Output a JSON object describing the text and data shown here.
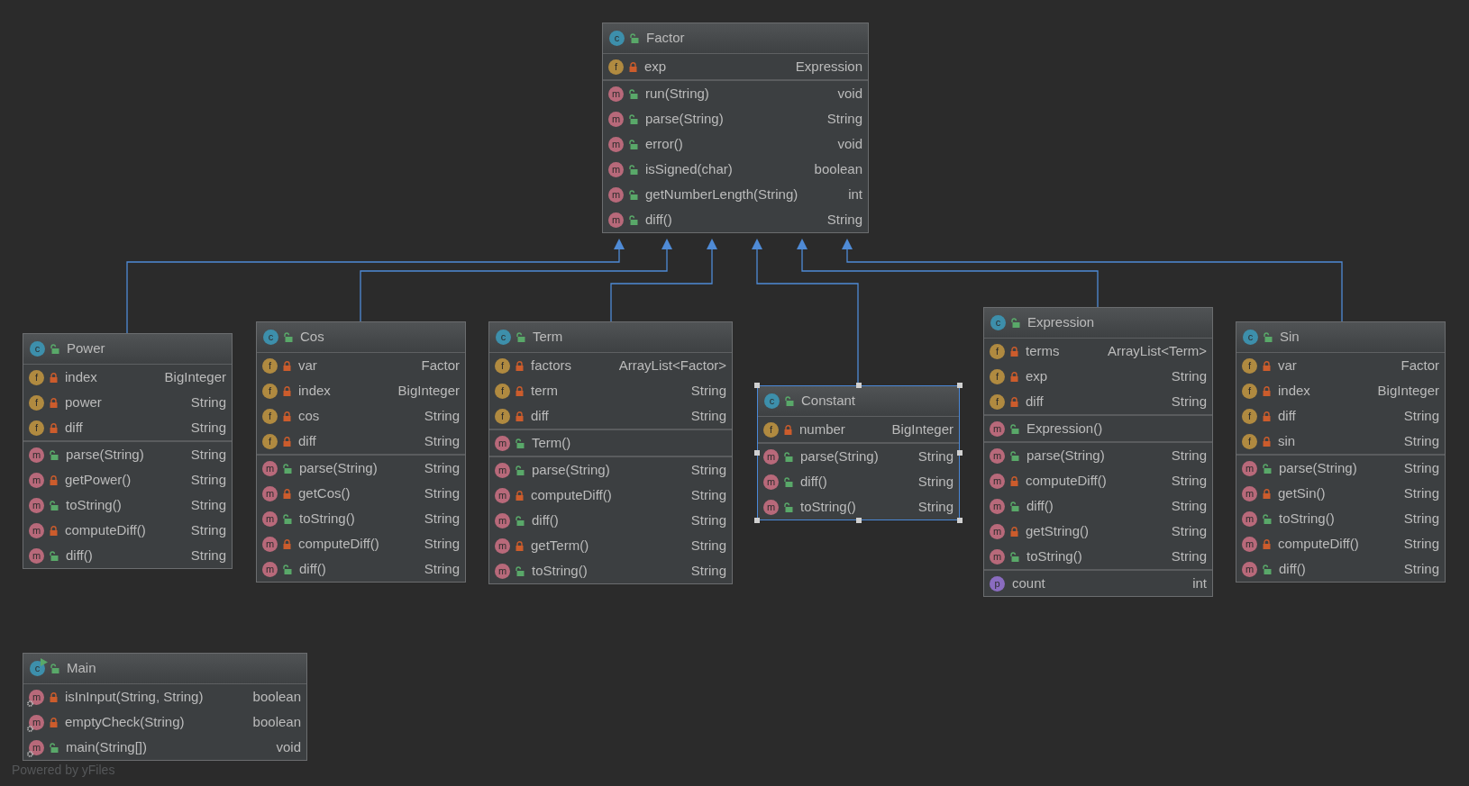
{
  "classes": [
    {
      "kind": "c",
      "name": "Factor",
      "runnable": false,
      "selected": false,
      "sections": [
        [
          {
            "kind": "f",
            "locked": true,
            "name": "exp",
            "type": "Expression"
          }
        ],
        [
          {
            "kind": "m",
            "locked": false,
            "name": "run(String)",
            "type": "void"
          },
          {
            "kind": "m",
            "locked": false,
            "name": "parse(String)",
            "type": "String"
          },
          {
            "kind": "m",
            "locked": false,
            "name": "error()",
            "type": "void"
          },
          {
            "kind": "m",
            "locked": false,
            "name": "isSigned(char)",
            "type": "boolean"
          },
          {
            "kind": "m",
            "locked": false,
            "name": "getNumberLength(String)",
            "type": "int"
          },
          {
            "kind": "m",
            "locked": false,
            "name": "diff()",
            "type": "String"
          }
        ]
      ]
    },
    {
      "kind": "c",
      "name": "Power",
      "runnable": false,
      "selected": false,
      "sections": [
        [
          {
            "kind": "f",
            "locked": true,
            "name": "index",
            "type": "BigInteger"
          },
          {
            "kind": "f",
            "locked": true,
            "name": "power",
            "type": "String"
          },
          {
            "kind": "f",
            "locked": true,
            "name": "diff",
            "type": "String"
          }
        ],
        [
          {
            "kind": "m",
            "locked": false,
            "name": "parse(String)",
            "type": "String"
          },
          {
            "kind": "m",
            "locked": true,
            "name": "getPower()",
            "type": "String"
          },
          {
            "kind": "m",
            "locked": false,
            "name": "toString()",
            "type": "String"
          },
          {
            "kind": "m",
            "locked": true,
            "name": "computeDiff()",
            "type": "String"
          },
          {
            "kind": "m",
            "locked": false,
            "name": "diff()",
            "type": "String"
          }
        ]
      ]
    },
    {
      "kind": "c",
      "name": "Cos",
      "runnable": false,
      "selected": false,
      "sections": [
        [
          {
            "kind": "f",
            "locked": true,
            "name": "var",
            "type": "Factor"
          },
          {
            "kind": "f",
            "locked": true,
            "name": "index",
            "type": "BigInteger"
          },
          {
            "kind": "f",
            "locked": true,
            "name": "cos",
            "type": "String"
          },
          {
            "kind": "f",
            "locked": true,
            "name": "diff",
            "type": "String"
          }
        ],
        [
          {
            "kind": "m",
            "locked": false,
            "name": "parse(String)",
            "type": "String"
          },
          {
            "kind": "m",
            "locked": true,
            "name": "getCos()",
            "type": "String"
          },
          {
            "kind": "m",
            "locked": false,
            "name": "toString()",
            "type": "String"
          },
          {
            "kind": "m",
            "locked": true,
            "name": "computeDiff()",
            "type": "String"
          },
          {
            "kind": "m",
            "locked": false,
            "name": "diff()",
            "type": "String"
          }
        ]
      ]
    },
    {
      "kind": "c",
      "name": "Term",
      "runnable": false,
      "selected": false,
      "sections": [
        [
          {
            "kind": "f",
            "locked": true,
            "name": "factors",
            "type": "ArrayList<Factor>"
          },
          {
            "kind": "f",
            "locked": true,
            "name": "term",
            "type": "String"
          },
          {
            "kind": "f",
            "locked": true,
            "name": "diff",
            "type": "String"
          }
        ],
        [
          {
            "kind": "m",
            "locked": false,
            "name": "Term()"
          }
        ],
        [
          {
            "kind": "m",
            "locked": false,
            "name": "parse(String)",
            "type": "String"
          },
          {
            "kind": "m",
            "locked": true,
            "name": "computeDiff()",
            "type": "String"
          },
          {
            "kind": "m",
            "locked": false,
            "name": "diff()",
            "type": "String"
          },
          {
            "kind": "m",
            "locked": true,
            "name": "getTerm()",
            "type": "String"
          },
          {
            "kind": "m",
            "locked": false,
            "name": "toString()",
            "type": "String"
          }
        ]
      ]
    },
    {
      "kind": "c",
      "name": "Constant",
      "runnable": false,
      "selected": true,
      "sections": [
        [
          {
            "kind": "f",
            "locked": true,
            "name": "number",
            "type": "BigInteger"
          }
        ],
        [
          {
            "kind": "m",
            "locked": false,
            "name": "parse(String)",
            "type": "String"
          },
          {
            "kind": "m",
            "locked": false,
            "name": "diff()",
            "type": "String"
          },
          {
            "kind": "m",
            "locked": false,
            "name": "toString()",
            "type": "String"
          }
        ]
      ]
    },
    {
      "kind": "c",
      "name": "Expression",
      "runnable": false,
      "selected": false,
      "sections": [
        [
          {
            "kind": "f",
            "locked": true,
            "name": "terms",
            "type": "ArrayList<Term>"
          },
          {
            "kind": "f",
            "locked": true,
            "name": "exp",
            "type": "String"
          },
          {
            "kind": "f",
            "locked": true,
            "name": "diff",
            "type": "String"
          }
        ],
        [
          {
            "kind": "m",
            "locked": false,
            "name": "Expression()"
          }
        ],
        [
          {
            "kind": "m",
            "locked": false,
            "name": "parse(String)",
            "type": "String"
          },
          {
            "kind": "m",
            "locked": true,
            "name": "computeDiff()",
            "type": "String"
          },
          {
            "kind": "m",
            "locked": false,
            "name": "diff()",
            "type": "String"
          },
          {
            "kind": "m",
            "locked": true,
            "name": "getString()",
            "type": "String"
          },
          {
            "kind": "m",
            "locked": false,
            "name": "toString()",
            "type": "String"
          }
        ],
        [
          {
            "kind": "p",
            "name": "count",
            "type": "int"
          }
        ]
      ]
    },
    {
      "kind": "c",
      "name": "Sin",
      "runnable": false,
      "selected": false,
      "sections": [
        [
          {
            "kind": "f",
            "locked": true,
            "name": "var",
            "type": "Factor"
          },
          {
            "kind": "f",
            "locked": true,
            "name": "index",
            "type": "BigInteger"
          },
          {
            "kind": "f",
            "locked": true,
            "name": "diff",
            "type": "String"
          },
          {
            "kind": "f",
            "locked": true,
            "name": "sin",
            "type": "String"
          }
        ],
        [
          {
            "kind": "m",
            "locked": false,
            "name": "parse(String)",
            "type": "String"
          },
          {
            "kind": "m",
            "locked": true,
            "name": "getSin()",
            "type": "String"
          },
          {
            "kind": "m",
            "locked": false,
            "name": "toString()",
            "type": "String"
          },
          {
            "kind": "m",
            "locked": true,
            "name": "computeDiff()",
            "type": "String"
          },
          {
            "kind": "m",
            "locked": false,
            "name": "diff()",
            "type": "String"
          }
        ]
      ]
    },
    {
      "kind": "c",
      "name": "Main",
      "runnable": true,
      "selected": false,
      "sections": [
        [
          {
            "kind": "m",
            "locked": true,
            "static": true,
            "name": "isInInput(String, String)",
            "type": "boolean"
          },
          {
            "kind": "m",
            "locked": true,
            "static": true,
            "name": "emptyCheck(String)",
            "type": "boolean"
          },
          {
            "kind": "m",
            "locked": false,
            "static": true,
            "name": "main(String[])",
            "type": "void"
          }
        ]
      ]
    }
  ],
  "footer": "Powered by yFiles"
}
